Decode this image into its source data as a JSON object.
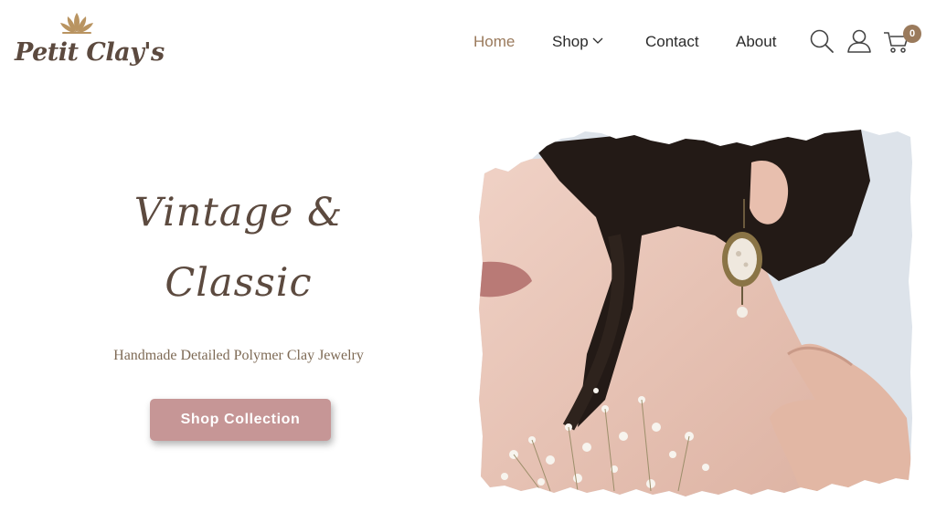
{
  "brand": {
    "name": "Petit Clay's",
    "accent_color": "#9a7a5c",
    "text_color": "#5c4a3f"
  },
  "nav": {
    "items": [
      {
        "label": "Home",
        "active": true
      },
      {
        "label": "Shop",
        "has_dropdown": true
      },
      {
        "label": "Contact"
      },
      {
        "label": "About"
      }
    ]
  },
  "header_icons": {
    "search": "search-icon",
    "account": "user-icon",
    "cart": "cart-icon",
    "cart_count": "0"
  },
  "hero": {
    "title_line1": "Vintage  &",
    "title_line2": "Classic",
    "subtitle": "Handmade Detailed Polymer Clay Jewelry",
    "cta_label": "Shop Collection",
    "cta_color": "#c69696",
    "image_subject": "woman wearing vintage oval earring with baby's breath flowers"
  }
}
